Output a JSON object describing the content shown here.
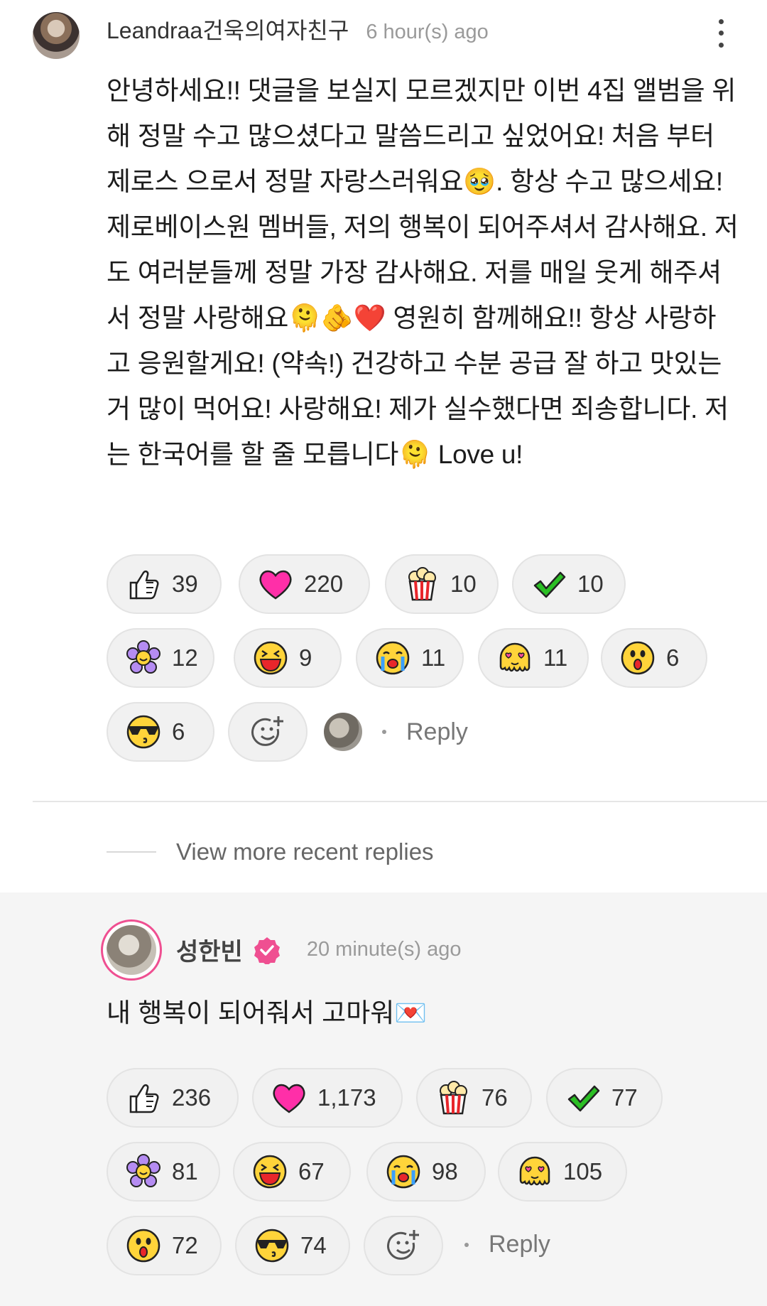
{
  "comment": {
    "author": "Leandraa건욱의여자친구",
    "time": "6 hour(s) ago",
    "text": "안녕하세요!! 댓글을 보실지 모르겠지만 이번 4집 앨범을 위해 정말 수고 많으셨다고 말씀드리고 싶었어요! 처음 부터 제로스 으로서 정말 자랑스러워요🥹. 항상 수고 많으세요! 제로베이스원 멤버들, 저의 행복이 되어주셔서 감사해요. 저도 여러분들께 정말 가장 감사해요. 저를 매일 웃게 해주셔서 정말 사랑해요🫠🫵❤️ 영원히 함께해요!! 항상 사랑하고 응원할게요! (약속!) 건강하고 수분 공급 잘 하고 맛있는 거 많이 먹어요! 사랑해요! 제가 실수했다면 죄송합니다. 저는 한국어를 할 줄 모릅니다🫠 Love u!",
    "reactions": [
      {
        "icon": "thumbs-up-icon",
        "count": "39"
      },
      {
        "icon": "heart-icon",
        "count": "220"
      },
      {
        "icon": "popcorn-icon",
        "count": "10"
      },
      {
        "icon": "check-icon",
        "count": "10"
      },
      {
        "icon": "flower-icon",
        "count": "12"
      },
      {
        "icon": "laughing-face-icon",
        "count": "9"
      },
      {
        "icon": "crying-face-icon",
        "count": "11"
      },
      {
        "icon": "heart-eyes-melting-icon",
        "count": "11"
      },
      {
        "icon": "surprised-face-icon",
        "count": "6"
      },
      {
        "icon": "sunglasses-kiss-icon",
        "count": "6"
      }
    ],
    "reply_label": "Reply"
  },
  "more_replies_label": "View more recent replies",
  "reply": {
    "author": "성한빈",
    "time": "20 minute(s) ago",
    "text": "내 행복이 되어줘서 고마워💌",
    "reactions": [
      {
        "icon": "thumbs-up-icon",
        "count": "236"
      },
      {
        "icon": "heart-icon",
        "count": "1,173"
      },
      {
        "icon": "popcorn-icon",
        "count": "76"
      },
      {
        "icon": "check-icon",
        "count": "77"
      },
      {
        "icon": "flower-icon",
        "count": "81"
      },
      {
        "icon": "laughing-face-icon",
        "count": "67"
      },
      {
        "icon": "crying-face-icon",
        "count": "98"
      },
      {
        "icon": "heart-eyes-melting-icon",
        "count": "105"
      },
      {
        "icon": "surprised-face-icon",
        "count": "72"
      },
      {
        "icon": "sunglasses-kiss-icon",
        "count": "74"
      }
    ],
    "reply_label": "Reply"
  },
  "colors": {
    "heart": "#ff2fa8",
    "check": "#2bbf24",
    "badge": "#ef4f91",
    "face": "#ffd43a"
  }
}
